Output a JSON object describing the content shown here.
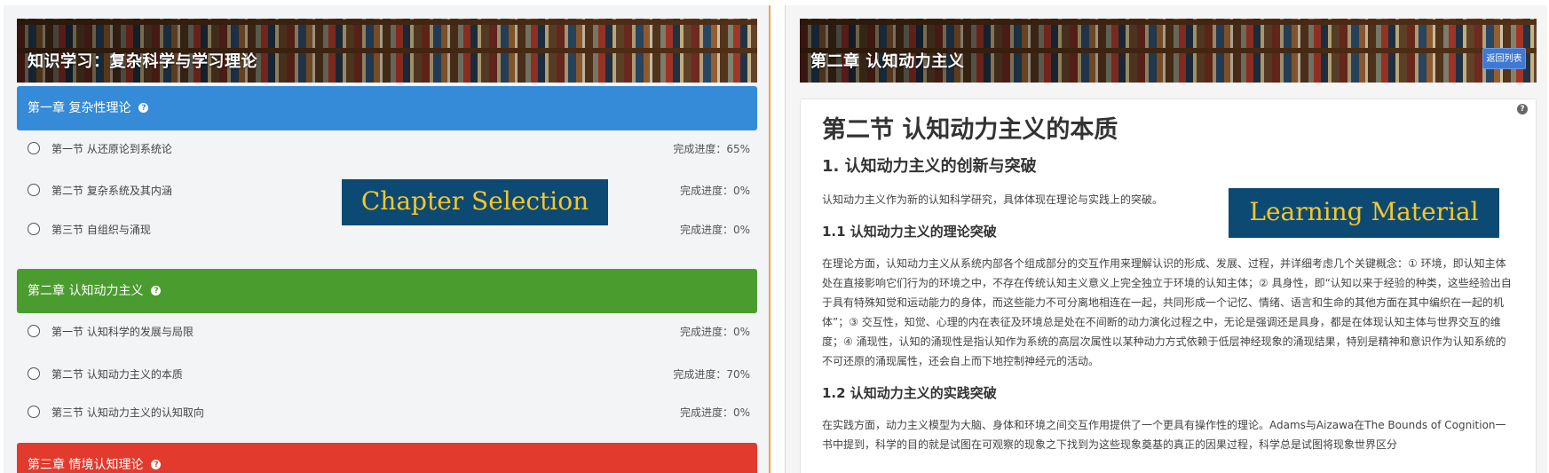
{
  "left": {
    "banner_title": "知识学习：复杂科学与学习理论",
    "chapters": [
      {
        "title": "第一章 复杂性理论",
        "color": "#358bd8",
        "sections": [
          {
            "label": "第一节 从还原论到系统论",
            "progress": "完成进度：65%"
          },
          {
            "label": "第二节 复杂系统及其内涵",
            "progress": "完成进度：0%"
          },
          {
            "label": "第三节 自组织与涌现",
            "progress": "完成进度：0%"
          }
        ]
      },
      {
        "title": "第二章 认知动力主义",
        "color": "#4b9c2f",
        "sections": [
          {
            "label": "第一节 认知科学的发展与局限",
            "progress": "完成进度：0%"
          },
          {
            "label": "第二节 认知动力主义的本质",
            "progress": "完成进度：70%"
          },
          {
            "label": "第三节 认知动力主义的认知取向",
            "progress": "完成进度：0%"
          }
        ]
      },
      {
        "title": "第三章 情境认知理论",
        "color": "#e23a2c",
        "sections": []
      }
    ],
    "overlay_label": "Chapter Selection"
  },
  "right": {
    "banner_title": "第二章 认知动力主义",
    "return_button": "返回列表",
    "overlay_label": "Learning Material",
    "article": {
      "title": "第二节 认知动力主义的本质",
      "h2": "1. 认知动力主义的创新与突破",
      "intro": "认知动力主义作为新的认知科学研究，具体体现在理论与实践上的突破。",
      "h3_theory": "1.1 认知动力主义的理论突破",
      "p_theory": "在理论方面，认知动力主义从系统内部各个组成部分的交互作用来理解认识的形成、发展、过程，并详细考虑几个关键概念：① 环境，即认知主体处在直接影响它们行为的环境之中，不存在传统认知主义意义上完全独立于环境的认知主体；② 具身性，即“认知以来于经验的种类，这些经验出自于具有特殊知觉和运动能力的身体，而这些能力不可分离地相连在一起，共同形成一个记忆、情绪、语言和生命的其他方面在其中编织在一起的机体”；③ 交互性，知觉、心理的内在表征及环境总是处在不间断的动力演化过程之中，无论是强调还是具身，都是在体现认知主体与世界交互的维度；④ 涌现性，认知的涌现性是指认知作为系统的高层次属性以某种动力方式依赖于低层神经现象的涌现结果，特别是精神和意识作为认知系统的不可还原的涌现属性，还会自上而下地控制神经元的活动。",
      "h3_practice": "1.2 认知动力主义的实践突破",
      "p_practice": "在实践方面，动力主义模型为大脑、身体和环境之间交互作用提供了一个更具有操作性的理论。Adams与Aizawa在The Bounds of Cognition一书中提到，科学的目的就是试图在可观察的现象之下找到为这些现象奠基的真正的因果过程，科学总是试图将现象世界区分"
    }
  }
}
